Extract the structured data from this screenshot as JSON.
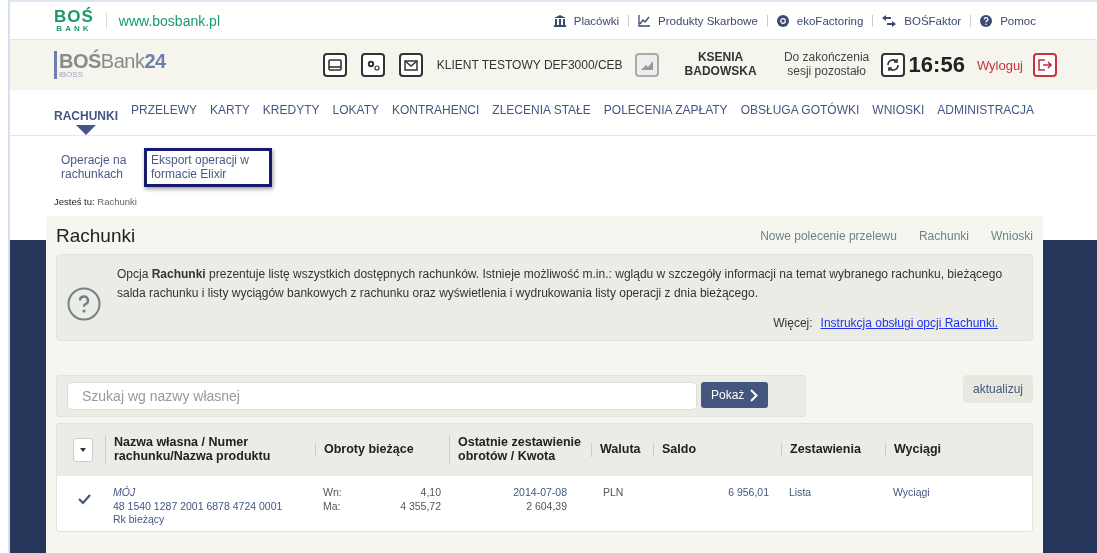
{
  "top_bar": {
    "logo_text": "BOŚ",
    "logo_sub": "BANK",
    "site": "www.bosbank.pl",
    "links": [
      {
        "label": "Placówki"
      },
      {
        "label": "Produkty Skarbowe"
      },
      {
        "label": "ekoFactoring"
      },
      {
        "label": "BOŚFaktor"
      },
      {
        "label": "Pomoc"
      }
    ]
  },
  "header": {
    "brand": "BOŚ",
    "brand_rest": "Bank",
    "brand_num": "24",
    "brand_sub": "iBOSS",
    "client": "KLIENT TESTOWY DEF3000/CEB",
    "user": "KSENIA BADOWSKA",
    "session_label": "Do zakończenia sesji pozostało",
    "timer": "16:56",
    "logout": "Wyloguj"
  },
  "nav": [
    {
      "label": "RACHUNKI",
      "selected": true
    },
    {
      "label": "PRZELEWY",
      "selected": false
    },
    {
      "label": "KARTY",
      "selected": false
    },
    {
      "label": "KREDYTY",
      "selected": false
    },
    {
      "label": "LOKATY",
      "selected": false
    },
    {
      "label": "KONTRAHENCI",
      "selected": false
    },
    {
      "label": "ZLECENIA STAŁE",
      "selected": false
    },
    {
      "label": "POLECENIA ZAPŁATY",
      "selected": false
    },
    {
      "label": "OBSŁUGA GOTÓWKI",
      "selected": false
    },
    {
      "label": "WNIOSKI",
      "selected": false
    },
    {
      "label": "ADMINISTRACJA",
      "selected": false
    }
  ],
  "subnav": [
    {
      "label": "Operacje na rachunkach",
      "focused": false
    },
    {
      "label": "Eksport operacji w formacie Elixir",
      "focused": true
    }
  ],
  "breadcrumb": {
    "label": "Jesteś tu:",
    "current": "Rachunki"
  },
  "panel": {
    "title": "Rachunki",
    "actions": [
      "Nowe polecenie przelewu",
      "Rachunki",
      "Wnioski"
    ],
    "info": "Opcja **Rachunki** prezentuje listę wszystkich dostępnych rachunków. Istnieje możliwość m.in.: wglądu w szczegóły informacji na temat wybranego rachunku, bieżącego salda rachunku i listy wyciągów bankowych z rachunku oraz wyświetlenia i wydrukowania listy operacji z dnia bieżącego.",
    "more_label": "Więcej:",
    "more_link": "Instrukcja obsługi opcji Rachunki."
  },
  "search": {
    "placeholder": "Szukaj wg nazwy własnej",
    "button": "Pokaż",
    "refresh": "aktualizuj"
  },
  "table": {
    "columns": [
      "Nazwa własna / Numer rachunku/Nazwa produktu",
      "Obroty bieżące",
      "Ostatnie zestawienie obrotów / Kwota",
      "Waluta",
      "Saldo",
      "Zestawienia",
      "Wyciągi"
    ],
    "rows": [
      {
        "checked": true,
        "name": "MÓJ",
        "number": "48 1540 1287 2001 6878 4724 0001",
        "product": "Rk bieżący",
        "debit_label": "Wn:",
        "debit": "4,10",
        "credit_label": "Ma:",
        "credit": "4 355,72",
        "last_date": "2014-07-08",
        "last_amount": "2 604,39",
        "currency": "PLN",
        "balance": "6 956,01",
        "statements": "Lista",
        "extracts": "Wyciągi"
      }
    ]
  }
}
